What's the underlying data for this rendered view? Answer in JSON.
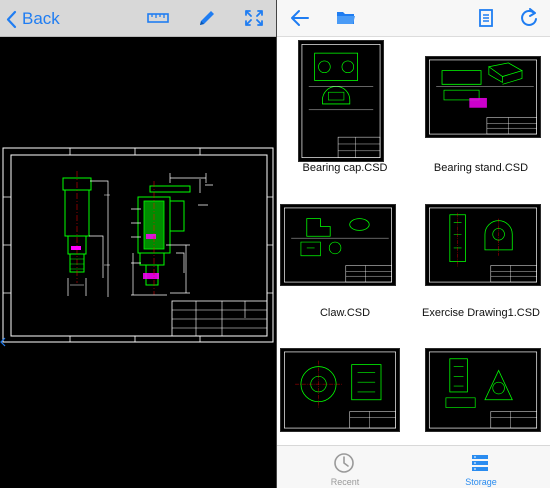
{
  "viewer": {
    "back_label": "Back",
    "icons": [
      "chevron-left-icon",
      "ruler-icon",
      "pencil-icon",
      "fit-screen-icon"
    ]
  },
  "browser": {
    "toolbar_icons": [
      "arrow-left-icon",
      "folder-icon",
      "document-icon",
      "refresh-icon"
    ],
    "files": [
      {
        "name": "Bearing cap.CSD"
      },
      {
        "name": "Bearing stand.CSD"
      },
      {
        "name": "Claw.CSD"
      },
      {
        "name": "Exercise Drawing1.CSD"
      },
      {
        "name": ""
      },
      {
        "name": ""
      }
    ]
  },
  "tabs": [
    {
      "label": "Recent",
      "icon": "clock-icon",
      "active": false
    },
    {
      "label": "Storage",
      "icon": "storage-icon",
      "active": true
    }
  ],
  "colors": {
    "accent": "#1f7df2",
    "cad_green": "#00ff00",
    "cad_white": "#ffffff",
    "cad_magenta": "#ff00ff"
  }
}
